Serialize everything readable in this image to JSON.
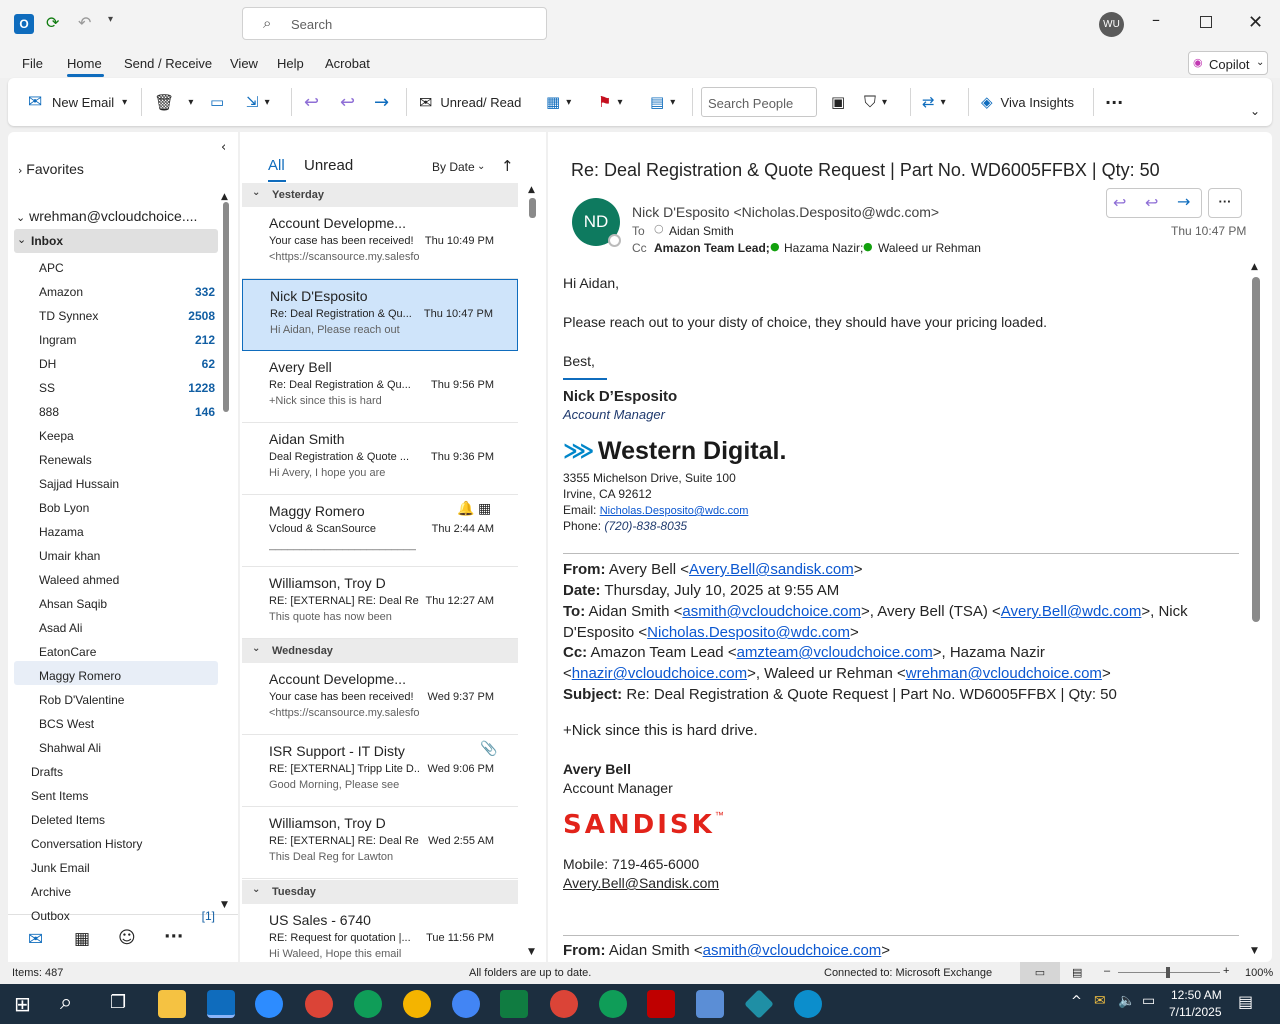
{
  "titlebar": {
    "search_placeholder": "Search",
    "avatar": "WU"
  },
  "menu": [
    "File",
    "Home",
    "Send / Receive",
    "View",
    "Help",
    "Acrobat"
  ],
  "copilot": "Copilot",
  "ribbon": {
    "new_email": "New Email",
    "unread_read": "Unread/ Read",
    "search_people": "Search People",
    "viva": "Viva Insights"
  },
  "folders": {
    "favorites": "Favorites",
    "account": "wrehman@vcloudchoice....",
    "inbox": "Inbox",
    "items": [
      {
        "label": "APC",
        "count": ""
      },
      {
        "label": "Amazon",
        "count": "332"
      },
      {
        "label": "TD Synnex",
        "count": "2508"
      },
      {
        "label": "Ingram",
        "count": "212"
      },
      {
        "label": "DH",
        "count": "62"
      },
      {
        "label": "SS",
        "count": "1228"
      },
      {
        "label": "888",
        "count": "146"
      },
      {
        "label": "Keepa",
        "count": ""
      },
      {
        "label": "Renewals",
        "count": ""
      },
      {
        "label": "Sajjad Hussain",
        "count": ""
      },
      {
        "label": "Bob Lyon",
        "count": ""
      },
      {
        "label": "Hazama",
        "count": ""
      },
      {
        "label": "Umair khan",
        "count": ""
      },
      {
        "label": "Waleed ahmed",
        "count": ""
      },
      {
        "label": "Ahsan Saqib",
        "count": ""
      },
      {
        "label": "Asad Ali",
        "count": ""
      },
      {
        "label": "EatonCare",
        "count": ""
      },
      {
        "label": "Maggy Romero",
        "count": ""
      },
      {
        "label": "Rob D'Valentine",
        "count": ""
      },
      {
        "label": "BCS West",
        "count": ""
      },
      {
        "label": "Shahwal Ali",
        "count": ""
      }
    ],
    "top": [
      {
        "label": "Drafts",
        "count": ""
      },
      {
        "label": "Sent Items",
        "count": ""
      },
      {
        "label": "Deleted Items",
        "count": ""
      },
      {
        "label": "Conversation History",
        "count": ""
      },
      {
        "label": "Junk Email",
        "count": ""
      },
      {
        "label": "Archive",
        "count": ""
      },
      {
        "label": "Outbox",
        "count": "[1]"
      }
    ]
  },
  "list": {
    "tab_all": "All",
    "tab_unread": "Unread",
    "sort": "By Date",
    "groups": {
      "yesterday": "Yesterday",
      "wednesday": "Wednesday",
      "tuesday": "Tuesday"
    },
    "messages": [
      {
        "from": "Account Developme...",
        "subject": "Your case has been received!",
        "time": "Thu 10:49 PM",
        "preview": "<https://scansource.my.salesforce"
      },
      {
        "from": "Nick D'Esposito",
        "subject": "Re: Deal Registration & Qu...",
        "time": "Thu 10:47 PM",
        "preview": "Hi Aidan,  Please reach out"
      },
      {
        "from": "Avery Bell",
        "subject": "Re: Deal Registration & Qu...",
        "time": "Thu 9:56 PM",
        "preview": "+Nick since this is hard"
      },
      {
        "from": "Aidan Smith",
        "subject": "Deal Registration & Quote ...",
        "time": "Thu 9:36 PM",
        "preview": "Hi Avery,  I hope you are"
      },
      {
        "from": "Maggy Romero",
        "subject": "Vcloud & ScanSource",
        "time": "Thu 2:44 AM",
        "preview": "________________________"
      },
      {
        "from": "Williamson, Troy D",
        "subject": "RE: [EXTERNAL] RE: Deal Re...",
        "time": "Thu 12:27 AM",
        "preview": "This quote has now been"
      },
      {
        "from": "Account Developme...",
        "subject": "Your case has been received!",
        "time": "Wed 9:37 PM",
        "preview": "<https://scansource.my.salesforce"
      },
      {
        "from": "ISR Support - IT Disty",
        "subject": "RE: [EXTERNAL] Tripp Lite D...",
        "time": "Wed 9:06 PM",
        "preview": "Good Morning,  Please see"
      },
      {
        "from": "Williamson, Troy D",
        "subject": "RE: [EXTERNAL] RE: Deal Re...",
        "time": "Wed 2:55 AM",
        "preview": "This Deal Reg for Lawton"
      },
      {
        "from": "US Sales - 6740",
        "subject": "RE: Request for quotation |...",
        "time": "Tue 11:56 PM",
        "preview": "Hi Waleed,  Hope this email"
      }
    ]
  },
  "email": {
    "subject": "Re: Deal Registration & Quote Request | Part No. WD6005FFBX | Qty: 50",
    "initials": "ND",
    "sender": "Nick D'Esposito <Nicholas.Desposito@wdc.com>",
    "to_label": "To",
    "to": "Aidan Smith",
    "cc_label": "Cc",
    "cc1": "Amazon Team Lead;",
    "cc2": "Hazama Nazir;",
    "cc3": "Waleed ur Rehman",
    "time": "Thu 10:47 PM",
    "greeting": "Hi Aidan,",
    "line1": "Please reach out to your disty of choice, they should have your pricing loaded.",
    "closing": "Best,",
    "sig_name": "Nick D’Esposito",
    "sig_title": "Account Manager",
    "logo_wd": "Western Digital.",
    "addr1": "3355 Michelson Drive, Suite 100",
    "addr2": "Irvine, CA 92612",
    "email_label": "Email: ",
    "email_link": "Nicholas.Desposito@wdc.com",
    "phone_label": "Phone: ",
    "phone": "(720)-838-8035",
    "q_from_label": "From:",
    "q_from": " Avery Bell <",
    "q_from_link": "Avery.Bell@sandisk.com",
    "q_from_end": ">",
    "q_date_label": "Date:",
    "q_date": " Thursday, July 10, 2025 at 9:55 AM",
    "q_to_label": "To:",
    "q_to1": " Aidan Smith <",
    "q_to1_link": "asmith@vcloudchoice.com",
    "q_to2": ">, Avery Bell (TSA) <",
    "q_to2_link": "Avery.Bell@wdc.com",
    "q_to3": ">, Nick",
    "q_to4": "D'Esposito <",
    "q_to4_link": "Nicholas.Desposito@wdc.com",
    "q_to5": ">",
    "q_cc_label": "Cc:",
    "q_cc1": " Amazon Team Lead <",
    "q_cc1_link": "amzteam@vcloudchoice.com",
    "q_cc2": ">, Hazama Nazir",
    "q_cc3": "<",
    "q_cc3_link": "hnazir@vcloudchoice.com",
    "q_cc4": ">, Waleed ur Rehman <",
    "q_cc4_link": "wrehman@vcloudchoice.com",
    "q_cc5": ">",
    "q_subj_label": "Subject:",
    "q_subj": " Re: Deal Registration & Quote Request | Part No. WD6005FFBX | Qty: 50",
    "q_body": "+Nick since this is hard drive.",
    "q_sig_name": "Avery Bell",
    "q_sig_title": "Account Manager",
    "logo_sandisk": "SANDISK",
    "mobile": "Mobile: 719-465-6000",
    "mobile_link": "Avery.Bell@Sandisk.com",
    "q2_from_label": "From:",
    "q2_from": " Aidan Smith <",
    "q2_from_link": "asmith@vcloudchoice.com",
    "q2_from_end": ">"
  },
  "status": {
    "items": "Items: 487",
    "sync": "All folders are up to date.",
    "connected": "Connected to: Microsoft Exchange",
    "zoom": "100%"
  },
  "taskbar": {
    "time": "12:50 AM",
    "date": "7/11/2025"
  },
  "colors": {
    "accent": "#0f6cbd",
    "avatar_bg": "#0e7a5f",
    "sandisk_red": "#e2231a"
  }
}
